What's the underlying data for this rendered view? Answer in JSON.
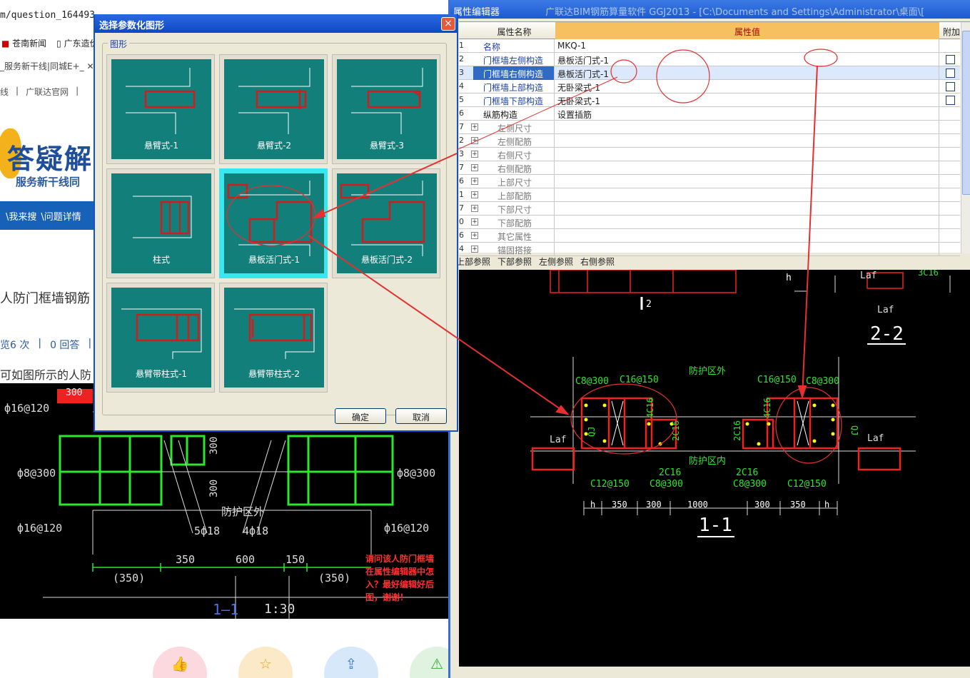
{
  "browser": {
    "url_prefix": "m/question_164493",
    "bookmarks": [
      "苍南新闻",
      "广东造价"
    ],
    "tab_text": "_服务新干线|同城E+_",
    "nav_links": [
      "线",
      "广联达官网"
    ]
  },
  "webpage": {
    "banner_title": "答疑解",
    "banner_subtitle": "服务新干线同",
    "bluebar_items": [
      "\\我来搜",
      "\\问题详情"
    ],
    "question_title": "人防门框墙钢筋",
    "stats": [
      "览6 次",
      "0 回答"
    ],
    "question_body": "可如图所示的人防",
    "cad_note_lines": [
      "请问该人防门框墙",
      "在属性编辑器中怎",
      "入？最好编辑好后",
      "图，谢谢！"
    ]
  },
  "cad_left": {
    "labels": {
      "top_width": "300",
      "rebar_a": "ф16@120",
      "rebar_b": "ф8@300",
      "rebar_c": "ф16@120",
      "rebar_d": "ф8@300",
      "rebar_e": "ф16@120",
      "dim_v1": "300",
      "dim_v2": "300",
      "zone": "防护区外",
      "bar1": "5ф18",
      "bar2": "4ф18",
      "dim1": "350",
      "dim2": "600",
      "dim3": "150",
      "dim4": "(350)",
      "dim5": "(350)",
      "section": "1—1",
      "scale": "1:30"
    }
  },
  "property_editor": {
    "title": "属性编辑器",
    "window_title": "广联达BIM钢筋算量软件 GGJ2013 - [C:\\Documents and Settings\\Administrator\\桌面\\[",
    "headers": {
      "name": "属性名称",
      "value": "属性值",
      "extra": "附加"
    },
    "rows": [
      {
        "idx": "1",
        "name": "名称",
        "value": "MKQ-1",
        "style": "link",
        "check": false
      },
      {
        "idx": "2",
        "name": "门框墙左侧构造",
        "value": "悬板活门式-1",
        "style": "link",
        "check": true
      },
      {
        "idx": "3",
        "name": "门框墙右侧构造",
        "value": "悬板活门式-1",
        "style": "sel",
        "check": true
      },
      {
        "idx": "4",
        "name": "门框墙上部构造",
        "value": "无卧梁式-1",
        "style": "link",
        "check": true
      },
      {
        "idx": "5",
        "name": "门框墙下部构造",
        "value": "无卧梁式-1",
        "style": "link",
        "check": true
      },
      {
        "idx": "6",
        "name": "纵筋构造",
        "value": "设置插筋",
        "style": "blk",
        "check": false
      },
      {
        "idx": "7",
        "name": "左侧尺寸",
        "value": "",
        "style": "gray",
        "check": false
      },
      {
        "idx": "2",
        "name": "左侧配筋",
        "value": "",
        "style": "gray",
        "check": false
      },
      {
        "idx": "3",
        "name": "右侧尺寸",
        "value": "",
        "style": "gray",
        "check": false
      },
      {
        "idx": "7",
        "name": "右侧配筋",
        "value": "",
        "style": "gray",
        "check": false
      },
      {
        "idx": "6",
        "name": "上部尺寸",
        "value": "",
        "style": "gray",
        "check": false
      },
      {
        "idx": "1",
        "name": "上部配筋",
        "value": "",
        "style": "gray",
        "check": false
      },
      {
        "idx": "7",
        "name": "下部尺寸",
        "value": "",
        "style": "gray",
        "check": false
      },
      {
        "idx": "0",
        "name": "下部配筋",
        "value": "",
        "style": "gray",
        "check": false
      },
      {
        "idx": "6",
        "name": "其它属性",
        "value": "",
        "style": "gray",
        "check": false
      },
      {
        "idx": "4",
        "name": "锚固搭接",
        "value": "",
        "style": "gray",
        "check": false
      }
    ],
    "ref_tabs": [
      "上部参照",
      "下部参照",
      "左侧参照",
      "右侧参照"
    ]
  },
  "cad_right": {
    "labels": {
      "sec2": "2",
      "sec22": "2-2",
      "h": "h",
      "laf_top": "Laf",
      "laf_bottom": "Laf",
      "c3": "3C16",
      "zone_out": "防护区外",
      "zone_in": "防护区内",
      "c8_l": "C8@300",
      "c16_l": "C16@150",
      "c16_r": "C16@150",
      "c8_r": "C8@300",
      "v4c16_l": "4C16",
      "v2c16_l": "2C16",
      "v4c16_r": "4C16",
      "v2c16_r": "2C16",
      "qj_l": "QJ",
      "qj_r": "QJ",
      "laf_l": "Laf",
      "laf_r": "Laf",
      "b2c16_l": "2C16",
      "b2c16_r": "2C16",
      "c12_l": "C12@150",
      "c8b_l": "C8@300",
      "c8b_r": "C8@300",
      "c12_r": "C12@150",
      "dims": [
        "h",
        "350",
        "300",
        "1000",
        "300",
        "350",
        "h"
      ],
      "sec11": "1-1"
    }
  },
  "dialog": {
    "title": "选择参数化图形",
    "group_label": "图形",
    "tiles": [
      {
        "caption": "悬臂式-1",
        "selected": false
      },
      {
        "caption": "悬臂式-2",
        "selected": false
      },
      {
        "caption": "悬臂式-3",
        "selected": false
      },
      {
        "caption": "柱式",
        "selected": false
      },
      {
        "caption": "悬板活门式-1",
        "selected": true
      },
      {
        "caption": "悬板活门式-2",
        "selected": false
      },
      {
        "caption": "悬臂带柱式-1",
        "selected": false
      },
      {
        "caption": "悬臂带柱式-2",
        "selected": false
      }
    ],
    "ok": "确定",
    "cancel": "取消",
    "close_icon": "×"
  },
  "colors": {
    "tile_bg": "#127f7a",
    "selected": "#39e8ee",
    "annotation_red": "#e53030",
    "cad_green": "#2ee62e"
  }
}
